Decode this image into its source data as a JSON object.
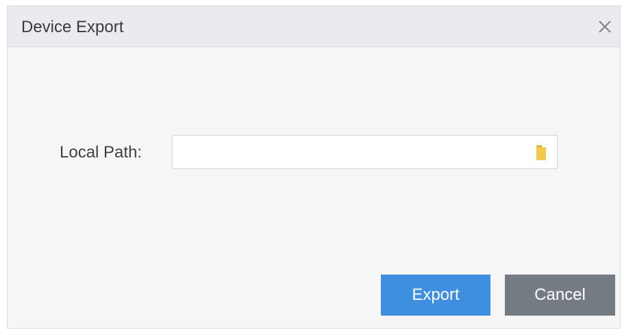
{
  "dialog": {
    "title": "Device Export",
    "close_icon": "close-icon"
  },
  "form": {
    "local_path_label": "Local Path:",
    "local_path_value": "",
    "browse_icon": "folder-icon"
  },
  "buttons": {
    "export_label": "Export",
    "cancel_label": "Cancel"
  },
  "colors": {
    "export": "#3f8fe0",
    "cancel": "#757b82",
    "titlebar": "#e9ebee",
    "folder": "#f2c94c"
  }
}
